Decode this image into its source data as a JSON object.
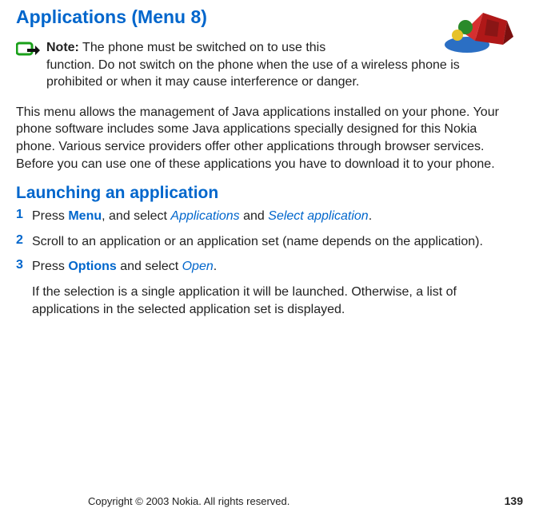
{
  "title": "Applications (Menu 8)",
  "note": {
    "label": "Note:",
    "text_1": "The phone must be switched on to use this",
    "text_2": "function. Do not switch on the phone when the use of a wireless phone is prohibited or when it may cause interference or danger."
  },
  "intro": "This menu allows the management of Java applications installed on your phone. Your phone software includes some Java applications specially designed for this Nokia phone. Various service providers offer other applications through browser services. Before you can use one of these applications you have to download it to your phone.",
  "section_title": "Launching an application",
  "steps": {
    "s1": {
      "num": "1",
      "pre": "Press ",
      "kw1": "Menu",
      "mid1": ", and select ",
      "kw2": "Applications",
      "mid2": " and ",
      "kw3": "Select application",
      "post": "."
    },
    "s2": {
      "num": "2",
      "text": "Scroll to an application or an application set (name depends on the application)."
    },
    "s3": {
      "num": "3",
      "pre": "Press ",
      "kw1": "Options",
      "mid1": " and select ",
      "kw2": "Open",
      "post": "."
    },
    "after": "If the selection is a single application it will be launched. Otherwise, a list of applications in the selected application set is displayed."
  },
  "footer": {
    "copyright": "Copyright © 2003 Nokia. All rights reserved.",
    "page": "139"
  }
}
